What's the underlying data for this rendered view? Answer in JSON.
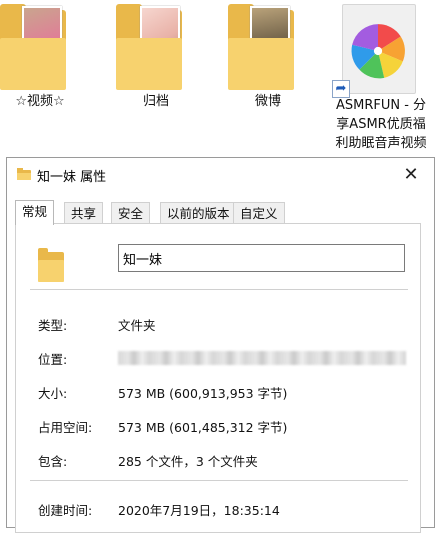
{
  "desktop": {
    "items": [
      {
        "label": "☆视频☆",
        "photo_colors": [
          "#c9a58e",
          "#e27a98"
        ]
      },
      {
        "label": "归档",
        "photo_colors": [
          "#f2c6c0",
          "#b07a6e"
        ]
      },
      {
        "label": "微博",
        "photo_colors": [
          "#7a6a4f",
          "#3b3024"
        ]
      },
      {
        "label_lines": [
          "ASMRFUN - 分",
          "享ASMR优质福",
          "利助眠音声视频"
        ]
      }
    ]
  },
  "dialog": {
    "title": "知一妹 属性",
    "close_glyph": "✕",
    "tabs": [
      "常规",
      "共享",
      "安全",
      "以前的版本",
      "自定义"
    ],
    "folder_name": "知一妹",
    "properties": [
      {
        "label": "类型:",
        "value": "文件夹"
      },
      {
        "label": "位置:",
        "value": ""
      },
      {
        "label": "大小:",
        "value": "573 MB (600,913,953 字节)"
      },
      {
        "label": "占用空间:",
        "value": "573 MB (601,485,312 字节)"
      },
      {
        "label": "包含:",
        "value": "285 个文件，3 个文件夹"
      },
      {
        "label": "创建时间:",
        "value": "2020年7月19日，18:35:14"
      }
    ]
  },
  "colors": {
    "folder_dark": "#e9b84a",
    "folder_light": "#f7d26e",
    "border": "#d0d0d0"
  }
}
